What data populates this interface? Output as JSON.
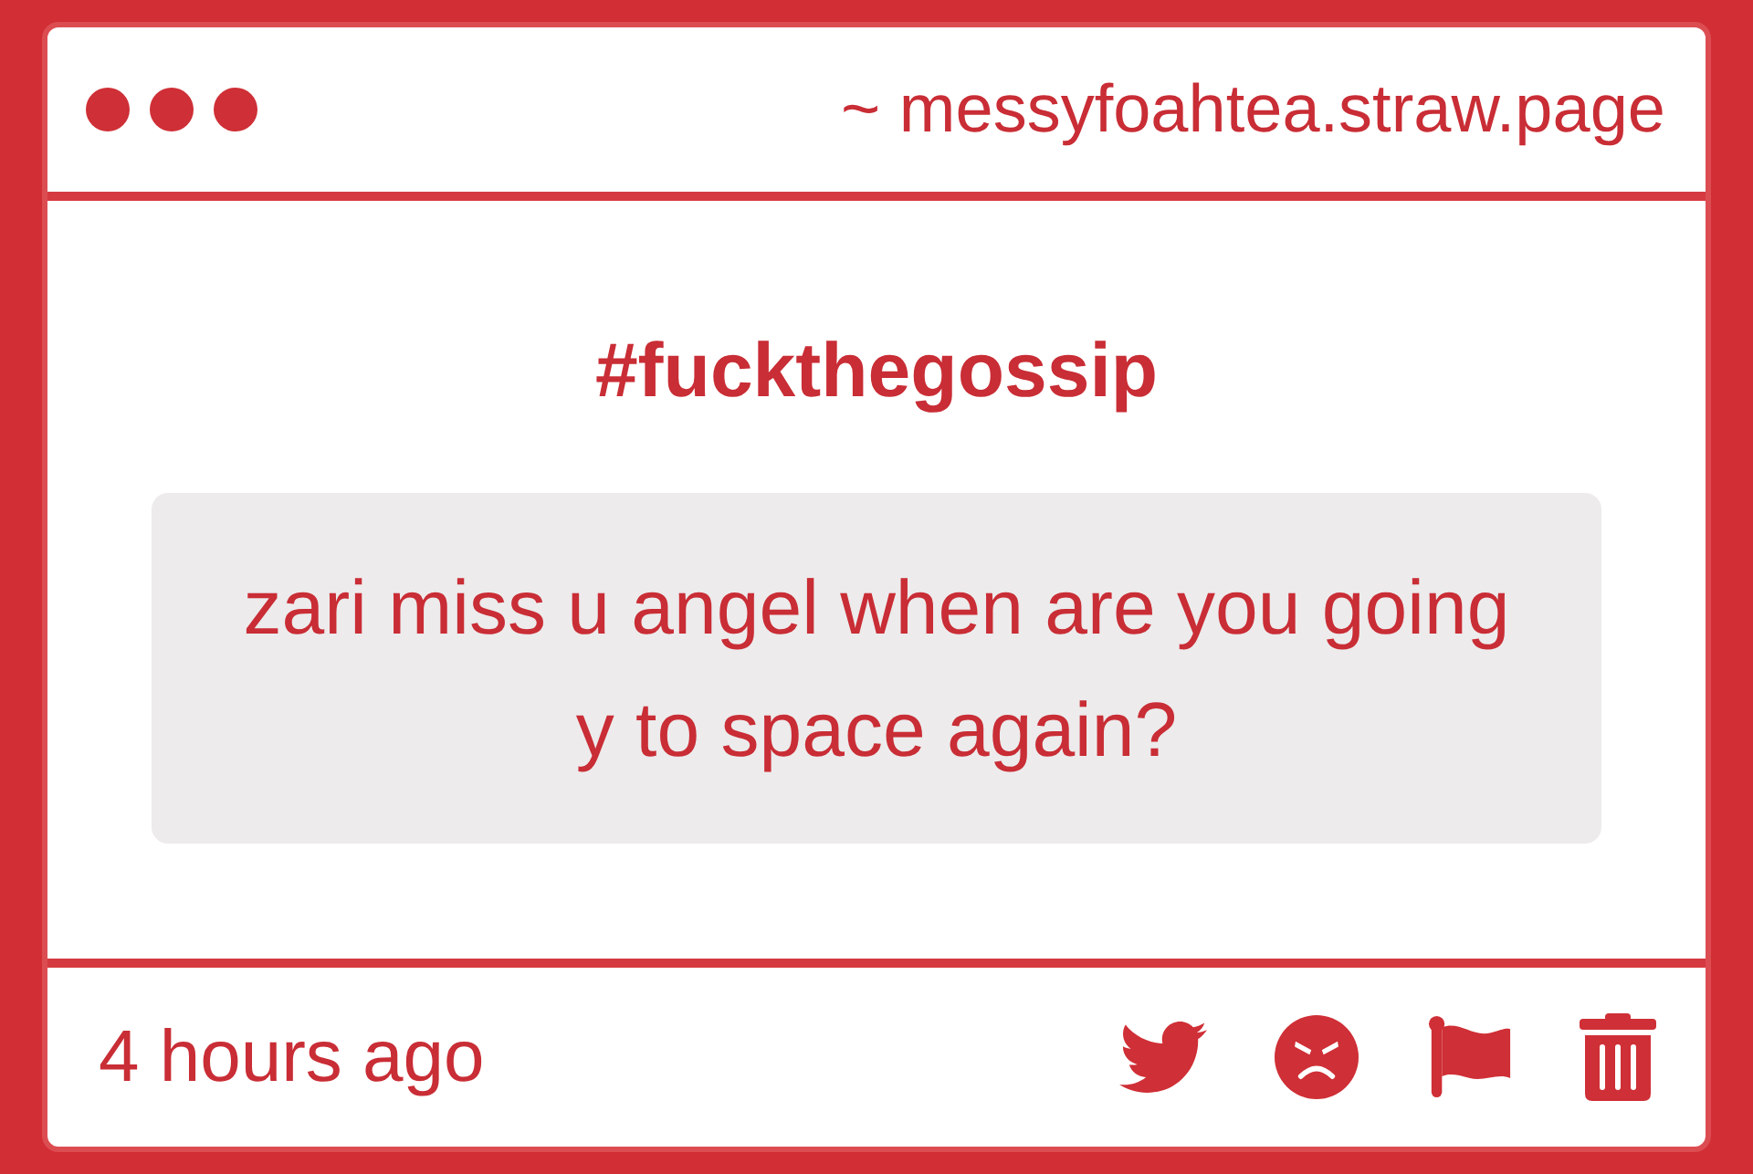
{
  "window": {
    "url": "~ messyfoahtea.straw.page"
  },
  "post": {
    "title": "#fuckthegossip",
    "message": "zari miss u angel when are you going\ny to space again?"
  },
  "footer": {
    "time": "4 hours ago",
    "actions": [
      {
        "kind": "twitter"
      },
      {
        "kind": "angry"
      },
      {
        "kind": "flag"
      },
      {
        "kind": "trash"
      }
    ]
  }
}
